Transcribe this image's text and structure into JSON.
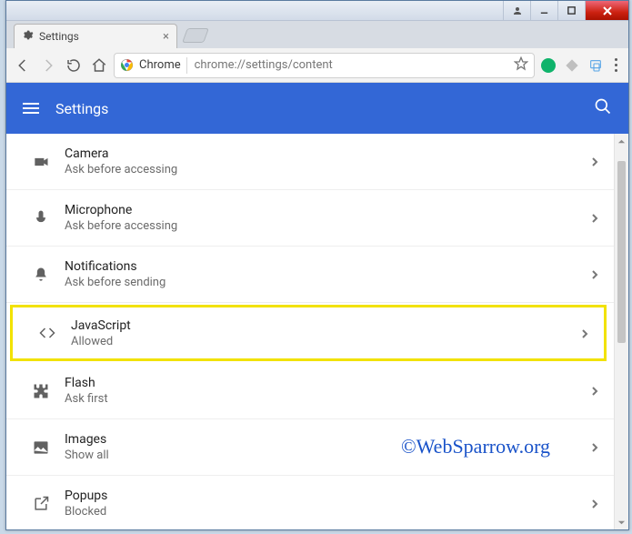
{
  "tab": {
    "title": "Settings"
  },
  "omnibox": {
    "origin_label": "Chrome",
    "url": "chrome://settings/content"
  },
  "header": {
    "title": "Settings"
  },
  "items": [
    {
      "title": "Camera",
      "sub": "Ask before accessing",
      "icon": "camera"
    },
    {
      "title": "Microphone",
      "sub": "Ask before accessing",
      "icon": "mic"
    },
    {
      "title": "Notifications",
      "sub": "Ask before sending",
      "icon": "bell"
    },
    {
      "title": "JavaScript",
      "sub": "Allowed",
      "icon": "code",
      "highlight": true
    },
    {
      "title": "Flash",
      "sub": "Ask first",
      "icon": "puzzle"
    },
    {
      "title": "Images",
      "sub": "Show all",
      "icon": "image"
    },
    {
      "title": "Popups",
      "sub": "Blocked",
      "icon": "launch"
    }
  ],
  "watermark": "©WebSparrow.org"
}
